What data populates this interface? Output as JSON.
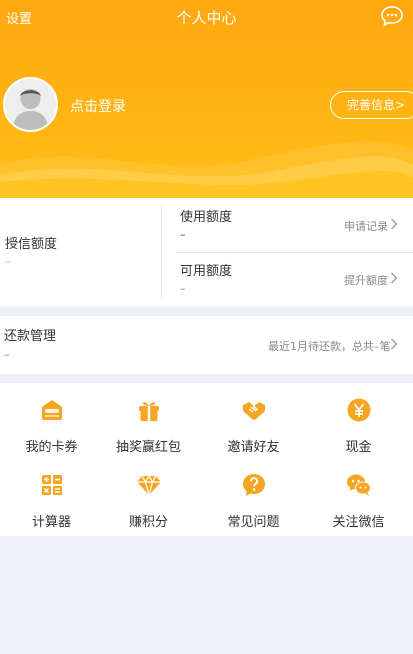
{
  "header": {
    "settings": "设置",
    "title": "个人中心",
    "login": "点击登录",
    "complete_info": "完善信息>"
  },
  "credit": {
    "auth_label": "授信额度",
    "auth_value": "–",
    "used_label": "使用额度",
    "used_value": "–",
    "apply_record": "申请记录",
    "avail_label": "可用额度",
    "avail_value": "–",
    "raise_limit": "提升额度"
  },
  "repay": {
    "label": "还款管理",
    "value": "–",
    "info": "最近1月待还款，总共–笔"
  },
  "grid": [
    {
      "label": "我的卡券",
      "icon": "wallet-icon"
    },
    {
      "label": "抽奖赢红包",
      "icon": "gift-icon"
    },
    {
      "label": "邀请好友",
      "icon": "handshake-icon"
    },
    {
      "label": "现金",
      "icon": "yuan-icon"
    },
    {
      "label": "计算器",
      "icon": "calculator-icon"
    },
    {
      "label": "赚积分",
      "icon": "diamond-icon"
    },
    {
      "label": "常见问题",
      "icon": "question-icon"
    },
    {
      "label": "关注微信",
      "icon": "wechat-icon"
    }
  ],
  "colors": {
    "accent": "#ffad14",
    "icon": "#f5a623",
    "link_blue": "#3d8ee8"
  }
}
